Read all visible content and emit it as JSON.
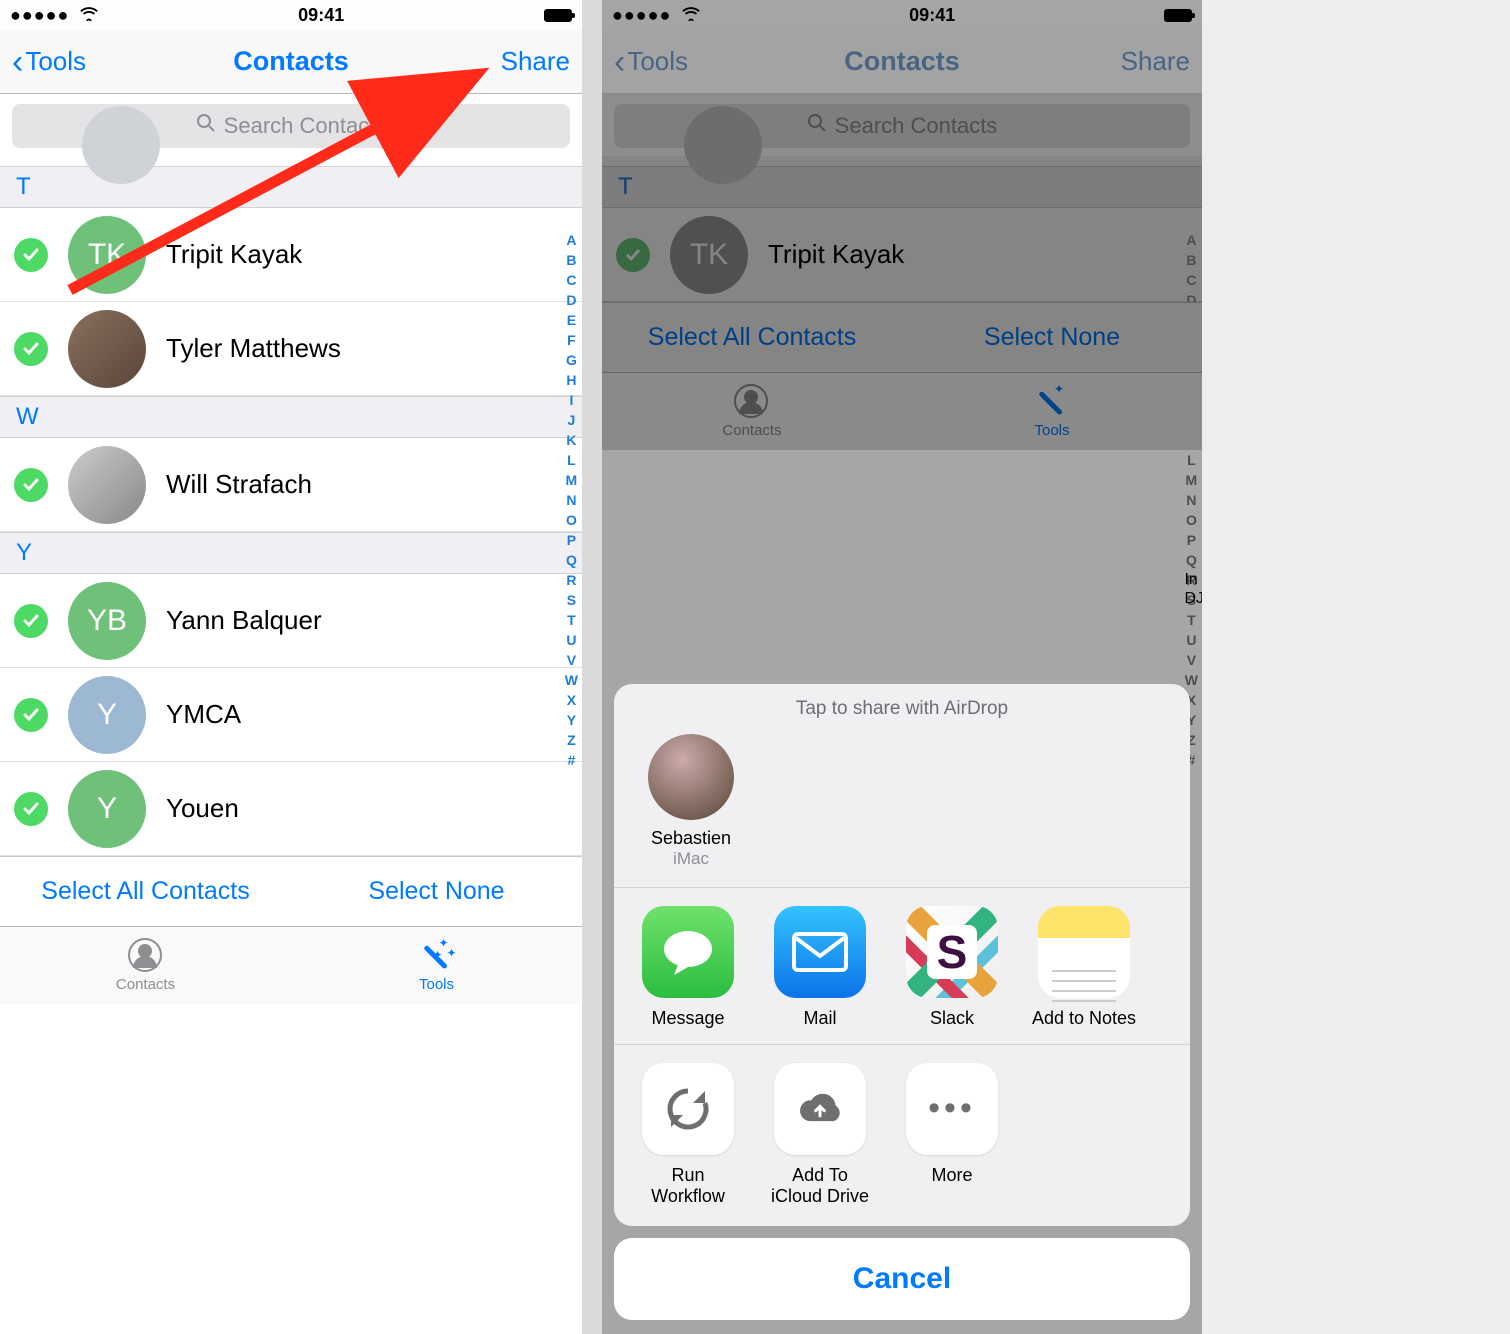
{
  "status": {
    "time": "09:41",
    "signal": "●●●●●",
    "wifi": "wifi-icon"
  },
  "nav": {
    "back": "Tools",
    "title": "Contacts",
    "action": "Share"
  },
  "search": {
    "placeholder": "Search Contacts"
  },
  "sections": [
    {
      "letter": "T",
      "rows": [
        {
          "name": "Tripit Kayak",
          "initials": "TK",
          "avatarColor": "#6fc17a",
          "selected": true
        },
        {
          "name": "Tyler Matthews",
          "photo": true,
          "selected": true
        }
      ]
    },
    {
      "letter": "W",
      "rows": [
        {
          "name": "Will Strafach",
          "photo2": true,
          "selected": true
        }
      ]
    },
    {
      "letter": "Y",
      "rows": [
        {
          "name": "Yann Balquer",
          "initials": "YB",
          "avatarColor": "#6fc17a",
          "selected": true
        },
        {
          "name": "YMCA",
          "initials": "Y",
          "avatarColor": "#9db8d3",
          "selected": true
        },
        {
          "name": "Youen",
          "initials": "Y",
          "avatarColor": "#6fc17a",
          "selected": true
        }
      ]
    }
  ],
  "index_letters": [
    "A",
    "B",
    "C",
    "D",
    "E",
    "F",
    "G",
    "H",
    "I",
    "J",
    "K",
    "L",
    "M",
    "N",
    "O",
    "P",
    "Q",
    "R",
    "S",
    "T",
    "U",
    "V",
    "W",
    "X",
    "Y",
    "Z",
    "#"
  ],
  "bottom": {
    "selectAll": "Select All Contacts",
    "selectNone": "Select None"
  },
  "tabs": {
    "contacts": "Contacts",
    "tools": "Tools"
  },
  "right": {
    "airdrop_header": "Tap to share with AirDrop",
    "airdrop_target": {
      "name": "Sebastien",
      "device": "iMac"
    },
    "apps": [
      {
        "label": "Message",
        "kind": "msg"
      },
      {
        "label": "Mail",
        "kind": "mail"
      },
      {
        "label": "Slack",
        "kind": "slack"
      },
      {
        "label": "Add to Notes",
        "kind": "notes"
      }
    ],
    "peek": "In\nDJ",
    "actions": [
      {
        "label": "Run\nWorkflow",
        "kind": "sync"
      },
      {
        "label": "Add To\niCloud Drive",
        "kind": "cloud"
      },
      {
        "label": "More",
        "kind": "more"
      }
    ],
    "cancel": "Cancel"
  }
}
